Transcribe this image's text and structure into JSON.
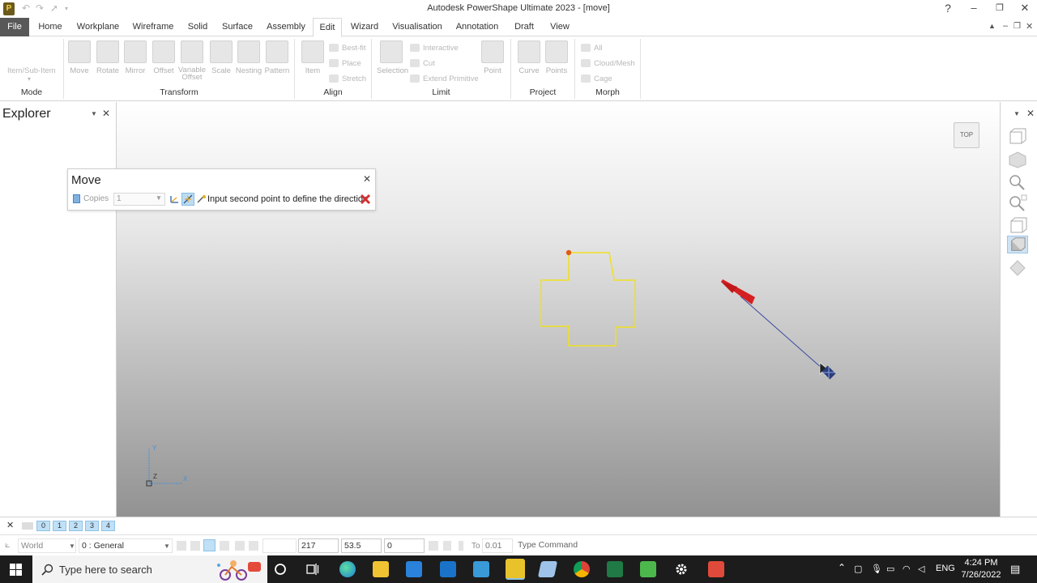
{
  "window": {
    "title": "Autodesk PowerShape Ultimate 2023 - [move]",
    "app_icon_letter": "P"
  },
  "menu_tabs": [
    "File",
    "Home",
    "Workplane",
    "Wireframe",
    "Solid",
    "Surface",
    "Assembly",
    "Edit",
    "Wizard",
    "Visualisation",
    "Annotation",
    "Draft",
    "View"
  ],
  "ribbon": {
    "mode": {
      "label": "Mode",
      "item": "Item/Sub-Item"
    },
    "transform": {
      "label": "Transform",
      "buttons": [
        "Move",
        "Rotate",
        "Mirror",
        "Offset",
        "Variable Offset",
        "Scale",
        "Nesting",
        "Pattern"
      ]
    },
    "align": {
      "label": "Align",
      "item": "Item",
      "small": [
        "Best-fit",
        "Place",
        "Stretch"
      ]
    },
    "limit": {
      "label": "Limit",
      "selection": "Selection",
      "small": [
        "Interactive",
        "Cut",
        "Extend Primitive"
      ],
      "point": "Point"
    },
    "project": {
      "label": "Project",
      "buttons": [
        "Curve",
        "Points"
      ]
    },
    "morph": {
      "label": "Morph",
      "small": [
        "All",
        "Cloud/Mesh",
        "Cage"
      ]
    }
  },
  "explorer": {
    "title": "Explorer"
  },
  "viewport": {
    "view_cube": "TOP",
    "axis_labels": [
      "Y",
      "Z",
      "X"
    ]
  },
  "move_dialog": {
    "title": "Move",
    "copies_label": "Copies",
    "copies_value": "1",
    "status": "Input second point to define the direction"
  },
  "levels": [
    "0",
    "1",
    "2",
    "3",
    "4"
  ],
  "statusbar": {
    "workplane": "World",
    "level": "0  : General",
    "x": "217",
    "y": "53.5",
    "z": "0",
    "to_label": "To",
    "tolerance": "0.01",
    "command_placeholder": "Type Command"
  },
  "taskbar": {
    "search_placeholder": "Type here to search",
    "lang": "ENG",
    "time": "4:24 PM",
    "date": "7/26/2022"
  },
  "colors": {
    "file_tab": "#585858",
    "shape_outline": "#f0e020",
    "direction_arrow": "#d42020",
    "taskbar": "#1c1c1c"
  }
}
